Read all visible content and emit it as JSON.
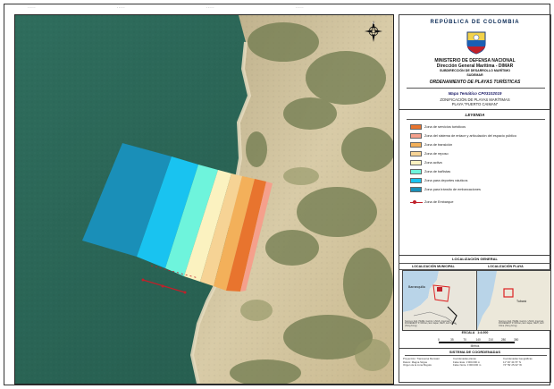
{
  "header": {
    "country": "REPÚBLICA DE COLOMBIA",
    "ministry": "MINISTERIO DE DEFENSA NACIONAL",
    "direction": "Dirección General Marítima - DIMAR",
    "subdirection": "SUBDIRECCIÓN DE DESARROLLO MARÍTIMO",
    "subdirection_short": "SUDEMAR",
    "ordering_title": "ORDENAMIENTO DE PLAYAS TURÍSTICAS",
    "map_number": "Mapa Temático CP03102019",
    "zonification": "ZONIFICACIÓN DE PLAYAS MARÍTIMAS",
    "beach": "PLAYA \"PUERTO CAIMAN\""
  },
  "legend": {
    "title": "LEYENDA",
    "items": [
      {
        "label": "Zona de servicios turísticos",
        "color": "#e8742e"
      },
      {
        "label": "Zona del sistema de enlace y articulación del espacio público",
        "color": "#f5a08c"
      },
      {
        "label": "Zona de transición",
        "color": "#f3b05a"
      },
      {
        "label": "Zona de reposo",
        "color": "#f6d395"
      },
      {
        "label": "Zona activa",
        "color": "#fbf2c0"
      },
      {
        "label": "Zona de bañistas",
        "color": "#6ef4dc"
      },
      {
        "label": "Zona para deportes náuticos",
        "color": "#19c3f0"
      },
      {
        "label": "Zona para tránsito de embarcaciones",
        "color": "#1a8fb8"
      }
    ],
    "embarkation_label": "Zona de Embarque",
    "embarkation_color": "#c0202a"
  },
  "location": {
    "title": "LOCALIZACIÓN GENERAL",
    "municipal_header": "LOCALIZACIÓN MUNICIPAL",
    "beach_header": "LOCALIZACIÓN PLAYA",
    "municipal_label": "Barranquilla",
    "beach_label": "Tubará",
    "credit": "Sources: Esri, HERE, Garmin, USGS, Intermap, INCREMENT P, NRCan, Esri Japan, METI, Esri China (Hong Kong)"
  },
  "scale": {
    "title": "ESCALA",
    "ratio": "1:4.000",
    "ticks": [
      "0",
      "35",
      "70",
      "140",
      "210",
      "280",
      "350"
    ],
    "unit": "Metros"
  },
  "coordinate_system": {
    "title": "SISTEMA DE COORDENADAS",
    "col1": [
      "Proyección: Transversa Mercator",
      "Datum: Magna Sirgas",
      "Origen de la zona Bogotá"
    ],
    "col2": [
      "Coordenadas planas",
      "Falso Este: 1'000.000 m",
      "Falso Norte: 1'000.000 m"
    ],
    "col3": [
      "Coordenadas Geográficas",
      "11° 00' 40.70\" N",
      "74° 59' 25.02\" W"
    ]
  },
  "map": {
    "sea_color": "#2c6b5a",
    "land_color": "#cdbf9c",
    "north_label": "N",
    "grid_labels_top": [
      "--",
      "--",
      "--",
      "--",
      "--",
      "--",
      "--",
      "--"
    ]
  }
}
